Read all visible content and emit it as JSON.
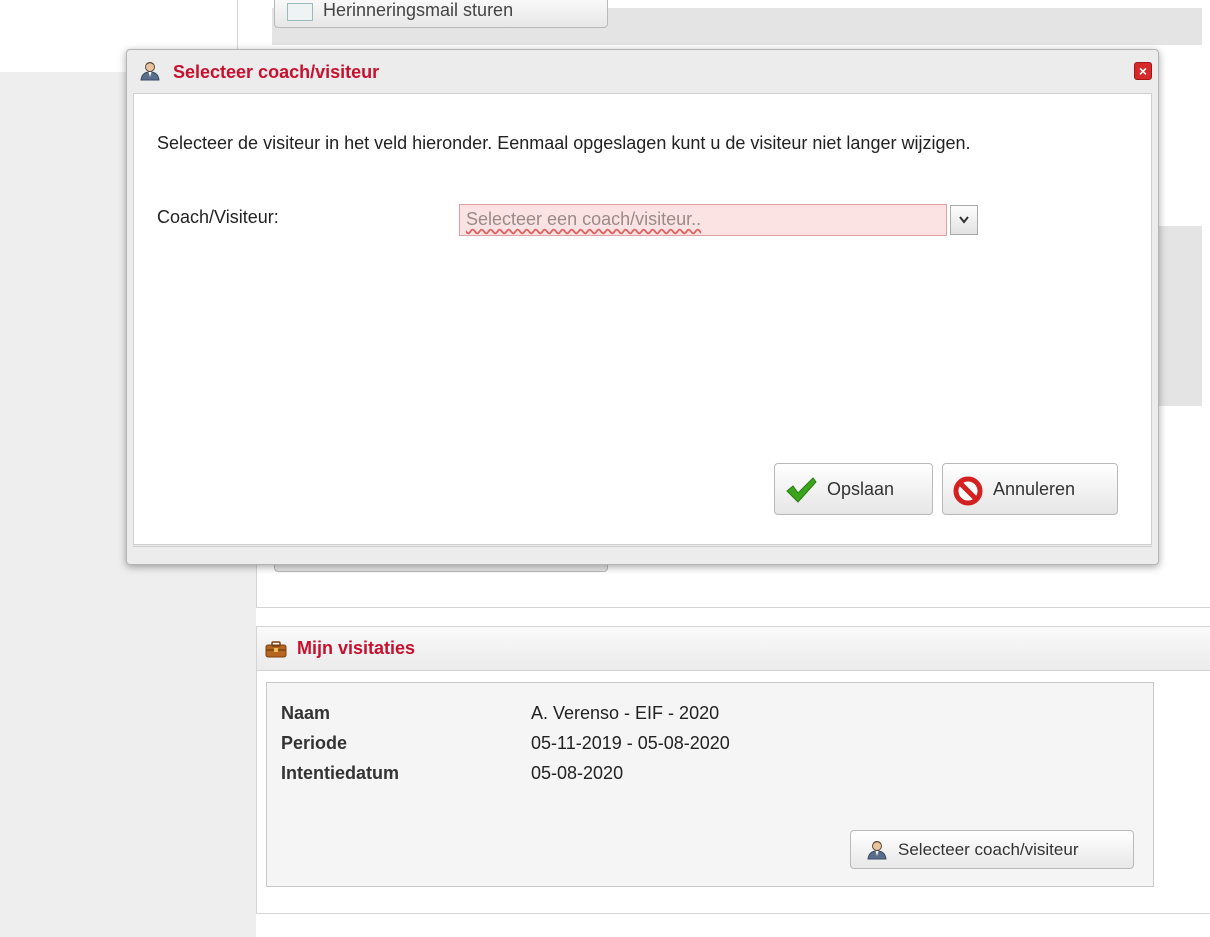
{
  "background": {
    "top_button_label": "Herinneringsmail sturen"
  },
  "dialog": {
    "title": "Selecteer coach/visiteur",
    "close_label": "×",
    "instruction": "Selecteer de visiteur in het veld hieronder. Eenmaal opgeslagen kunt u de visiteur niet langer wijzigen.",
    "field_label": "Coach/Visiteur:",
    "field_placeholder": "Selecteer een coach/visiteur..",
    "save_label": "Opslaan",
    "cancel_label": "Annuleren"
  },
  "visitaties": {
    "title": "Mijn visitaties",
    "rows": [
      {
        "label": "Naam",
        "value": "A. Verenso - EIF - 2020"
      },
      {
        "label": "Periode",
        "value": "05-11-2019 - 05-08-2020"
      },
      {
        "label": "Intentiedatum",
        "value": "05-08-2020"
      }
    ],
    "select_button_label": "Selecteer coach/visiteur"
  },
  "icons": {
    "dialog_title": "user-icon",
    "close": "close-icon",
    "save": "checkmark-icon",
    "cancel": "no-entry-icon",
    "panel": "briefcase-icon",
    "select_button": "user-icon"
  },
  "colors": {
    "title_red": "#c8102e",
    "invalid_field_bg": "#fbe3e3",
    "save_green": "#3aa51b",
    "cancel_red": "#d42020"
  }
}
